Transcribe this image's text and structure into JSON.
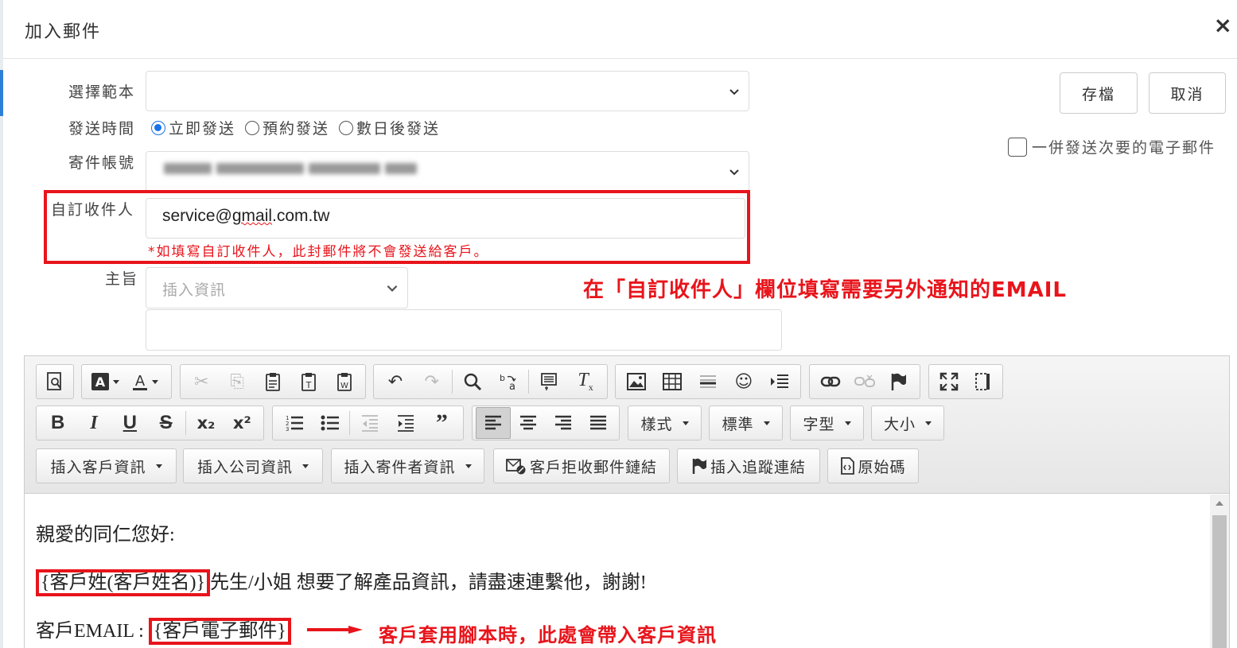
{
  "modal": {
    "title": "加入郵件",
    "close_label": "×"
  },
  "form": {
    "template_label": "選擇範本",
    "template_value": "",
    "send_time_label": "發送時間",
    "send_options": [
      "立即發送",
      "預約發送",
      "數日後發送"
    ],
    "send_selected": 0,
    "sender_label": "寄件帳號",
    "recipient_label": "自訂收件人",
    "recipient_value_pre": "service@",
    "recipient_value_mid": "gmail",
    "recipient_value_post": ".com.tw",
    "recipient_hint": "*如填寫自訂收件人，此封郵件將不會發送給客戶。",
    "subject_label": "主旨",
    "subject_insert_placeholder": "插入資訊",
    "subject_value": ""
  },
  "actions": {
    "save": "存檔",
    "cancel": "取消",
    "secondary_email_label": "一併發送次要的電子郵件"
  },
  "annotations": {
    "recipient_note": "在「自訂收件人」欄位填寫需要另外通知的EMAIL",
    "customer_note": "客戶套用腳本時，此處會帶入客戶資訊"
  },
  "toolbar": {
    "row1_icons": [
      "preview-icon",
      "bg-color-icon",
      "text-color-icon",
      "cut-icon",
      "copy-icon",
      "paste-icon",
      "paste-text-icon",
      "paste-word-icon",
      "undo-icon",
      "redo-icon",
      "find-icon",
      "replace-icon",
      "select-all-icon",
      "remove-format-icon",
      "image-icon",
      "table-icon",
      "horizontal-rule-icon",
      "smiley-icon",
      "page-break-icon",
      "link-icon",
      "unlink-icon",
      "anchor-icon",
      "maximize-icon",
      "show-blocks-icon"
    ],
    "bold": "B",
    "italic": "I",
    "underline": "U",
    "strike": "S",
    "sub": "x₂",
    "sup": "x²",
    "style_label": "樣式",
    "format_label": "標準",
    "font_label": "字型",
    "size_label": "大小",
    "insert_customer": "插入客戶資訊",
    "insert_company": "插入公司資訊",
    "insert_sender": "插入寄件者資訊",
    "unsubscribe_link": "客戶拒收郵件鏈結",
    "tracking_link": "插入追蹤連結",
    "source": "原始碼"
  },
  "content": {
    "greeting": "親愛的同仁您好:",
    "line2_token": "{客戶姓(客戶姓名)}",
    "line2_rest": "先生/小姐 想要了解產品資訊，請盡速連繫他，謝謝!",
    "line3_prefix": "客戶EMAIL : ",
    "line3_token": "{客戶電子郵件}"
  },
  "colors": {
    "accent_red": "#e8141b",
    "radio_blue": "#1a73e8"
  }
}
